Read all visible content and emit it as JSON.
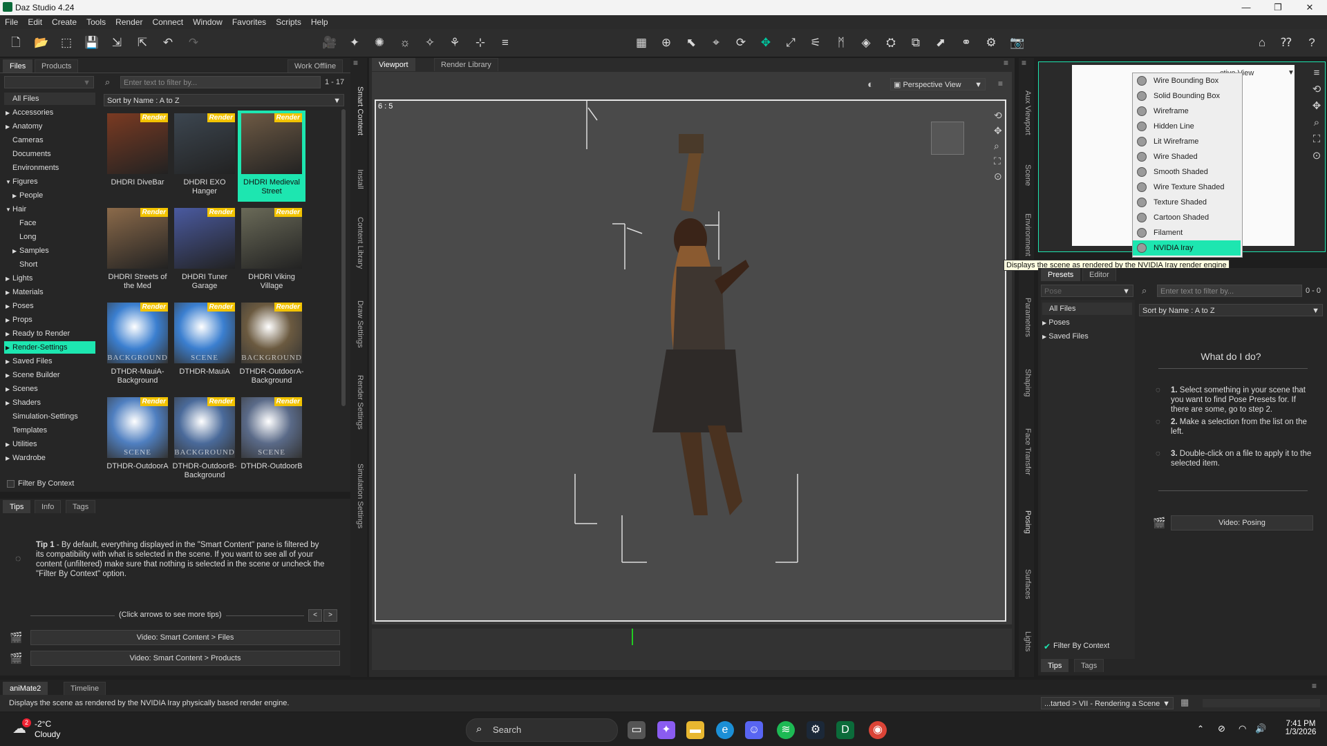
{
  "window": {
    "title": "Daz Studio 4.24"
  },
  "menu": [
    "File",
    "Edit",
    "Create",
    "Tools",
    "Render",
    "Connect",
    "Window",
    "Favorites",
    "Scripts",
    "Help"
  ],
  "left_panel": {
    "tabs": [
      "Files",
      "Products"
    ],
    "work_offline": "Work Offline",
    "filter_placeholder": "Enter text to filter by...",
    "count": "1 - 17",
    "sort": "Sort by Name : A to Z",
    "categories": [
      {
        "label": "All Files",
        "arrow": ""
      },
      {
        "label": "Accessories",
        "arrow": "▶"
      },
      {
        "label": "Anatomy",
        "arrow": "▶"
      },
      {
        "label": "Cameras",
        "arrow": ""
      },
      {
        "label": "Documents",
        "arrow": ""
      },
      {
        "label": "Environments",
        "arrow": ""
      },
      {
        "label": "Figures",
        "arrow": "▼"
      },
      {
        "label": "People",
        "arrow": "▶"
      },
      {
        "label": "Hair",
        "arrow": "▼"
      },
      {
        "label": "Face",
        "arrow": ""
      },
      {
        "label": "Long",
        "arrow": ""
      },
      {
        "label": "Samples",
        "arrow": "▶"
      },
      {
        "label": "Short",
        "arrow": ""
      },
      {
        "label": "Lights",
        "arrow": "▶"
      },
      {
        "label": "Materials",
        "arrow": "▶"
      },
      {
        "label": "Poses",
        "arrow": "▶"
      },
      {
        "label": "Props",
        "arrow": "▶"
      },
      {
        "label": "Ready to Render",
        "arrow": "▶"
      },
      {
        "label": "Render-Settings",
        "arrow": "▶"
      },
      {
        "label": "Saved Files",
        "arrow": "▶"
      },
      {
        "label": "Scene Builder",
        "arrow": "▶"
      },
      {
        "label": "Scenes",
        "arrow": "▶"
      },
      {
        "label": "Shaders",
        "arrow": "▶"
      },
      {
        "label": "Simulation-Settings",
        "arrow": ""
      },
      {
        "label": "Templates",
        "arrow": ""
      },
      {
        "label": "Utilities",
        "arrow": "▶"
      },
      {
        "label": "Wardrobe",
        "arrow": "▶"
      }
    ],
    "filter_by_context": "Filter By Context",
    "thumbs": [
      {
        "label": "DHDRI DiveBar",
        "tag": "Render",
        "color": "#7a3a22"
      },
      {
        "label": "DHDRI EXO Hanger",
        "tag": "Render",
        "color": "#3c4650"
      },
      {
        "label": "DHDRI Medieval Street",
        "tag": "Render",
        "color": "#6e5a44"
      },
      {
        "label": "DHDRI Streets of the Med",
        "tag": "Render",
        "color": "#8b6a4a"
      },
      {
        "label": "DHDRI Tuner Garage",
        "tag": "Render",
        "color": "#4a5aa0"
      },
      {
        "label": "DHDRI Viking Village",
        "tag": "Render",
        "color": "#6a6a58"
      },
      {
        "label": "DTHDR-MauiA-Background",
        "tag": "Render",
        "color": "#3b7fd0",
        "word": "BACKGROUND"
      },
      {
        "label": "DTHDR-MauiA",
        "tag": "Render",
        "color": "#3b7fd0",
        "word": "SCENE"
      },
      {
        "label": "DTHDR-OutdoorA-Background",
        "tag": "Render",
        "color": "#6b5a40",
        "word": "BACKGROUND"
      },
      {
        "label": "DTHDR-OutdoorA",
        "tag": "Render",
        "color": "#4f7fc0",
        "word": "SCENE"
      },
      {
        "label": "DTHDR-OutdoorB-Background",
        "tag": "Render",
        "color": "#4a6a9a",
        "word": "BACKGROUND"
      },
      {
        "label": "DTHDR-OutdoorB",
        "tag": "Render",
        "color": "#5a6a88",
        "word": "SCENE"
      }
    ],
    "side_tabs": [
      "Smart Content",
      "Install",
      "Content Library",
      "Draw Settings",
      "Render Settings",
      "Simulation Settings"
    ]
  },
  "tips_panel": {
    "tabs": [
      "Tips",
      "Info",
      "Tags"
    ],
    "tip_label": "Tip 1",
    "tip_text": " - By default, everything displayed in the \"Smart Content\" pane is filtered by its compatibility with what is selected in the scene. If you want to see all of your content (unfiltered) make sure that nothing is selected in the scene or uncheck the \"Filter By Context\" option.",
    "nav_hint": "(Click arrows to see more tips)",
    "video1": "Video: Smart Content > Files",
    "video2": "Video: Smart Content > Products"
  },
  "viewport": {
    "tabs": [
      "Viewport",
      "Render Library"
    ],
    "camera": "Perspective View",
    "aspect": "6 : 5"
  },
  "aux": {
    "side_tabs": [
      "Aux Viewport",
      "Scene",
      "Environment"
    ],
    "camera": "ctive View",
    "tooltip": "Displays the scene as rendered by the NVIDIA Iray render engine",
    "draw_styles": [
      "Wire Bounding Box",
      "Solid Bounding Box",
      "Wireframe",
      "Hidden Line",
      "Lit Wireframe",
      "Wire Shaded",
      "Smooth Shaded",
      "Wire Texture Shaded",
      "Texture Shaded",
      "Cartoon Shaded",
      "Filament",
      "NVIDIA Iray"
    ]
  },
  "pose_panel": {
    "tabs": [
      "Presets",
      "Editor"
    ],
    "type_dropdown": "Pose",
    "filter_placeholder": "Enter text to filter by...",
    "count": "0 - 0",
    "sort": "Sort by Name : A to Z",
    "categories": [
      {
        "label": "All Files",
        "arrow": ""
      },
      {
        "label": "Poses",
        "arrow": "▶"
      },
      {
        "label": "Saved Files",
        "arrow": "▶"
      }
    ],
    "what_title": "What do I do?",
    "steps": [
      {
        "num": "1.",
        "text": " Select something in your scene that you want to find Pose Presets for. If there are some, go to step 2."
      },
      {
        "num": "2.",
        "text": " Make a selection from the list on the left."
      },
      {
        "num": "3.",
        "text": " Double-click on a file to apply it to the selected item."
      }
    ],
    "video": "Video: Posing",
    "filter_by_context": "Filter By Context",
    "side_tabs": [
      "Parameters",
      "Shaping",
      "Face Transfer",
      "Posing",
      "Surfaces",
      "Lights"
    ],
    "bottom_tabs": [
      "Tips",
      "Tags"
    ]
  },
  "timeline": {
    "tabs": [
      "aniMate2",
      "Timeline"
    ]
  },
  "status": {
    "text": "Displays the scene as rendered by the NVIDIA Iray physically based render engine.",
    "lesson": "...tarted > VII - Rendering a Scene"
  },
  "taskbar": {
    "weather_temp": "-2°C",
    "weather_desc": "Cloudy",
    "weather_badge": "2",
    "search": "Search",
    "time": "7:41 PM",
    "date": "1/3/2026"
  },
  "colors": {
    "accent": "#1de6b0",
    "render_tag": "#f2c300",
    "viewport_bg": "#4a4a4a"
  }
}
